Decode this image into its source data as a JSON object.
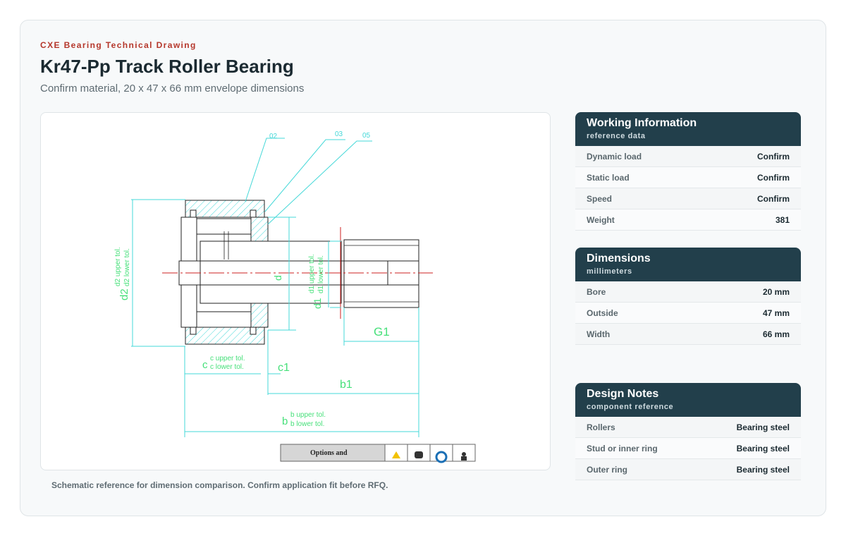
{
  "header": {
    "eyebrow": "CXE Bearing Technical Drawing",
    "title": "Kr47-Pp Track Roller Bearing",
    "subtitle": "Confirm material, 20 x 47 x 66 mm envelope dimensions"
  },
  "drawing": {
    "callouts": [
      "02",
      "03",
      "05"
    ],
    "dims": {
      "d2": "d2",
      "d2_upper": "d2 upper tol.",
      "d2_lower": "d2 lower tol.",
      "d": "d",
      "d1": "d1",
      "d1_upper": "d1 upper tol.",
      "d1_lower": "d1 lower tol.",
      "g1": "G1",
      "c": "c",
      "c_upper": "c upper tol.",
      "c_lower": "c lower tol.",
      "c1": "c1",
      "b1": "b1",
      "b": "b",
      "b_upper": "b upper tol.",
      "b_lower": "b lower tol."
    },
    "options_label": "Options and"
  },
  "caption": "Schematic reference for dimension comparison. Confirm application fit before RFQ.",
  "panels": {
    "working": {
      "title": "Working Information",
      "subtitle": "reference data",
      "rows": [
        {
          "label": "Dynamic load",
          "value": "Confirm"
        },
        {
          "label": "Static load",
          "value": "Confirm"
        },
        {
          "label": "Speed",
          "value": "Confirm"
        },
        {
          "label": "Weight",
          "value": "381"
        }
      ]
    },
    "dimensions": {
      "title": "Dimensions",
      "subtitle": "millimeters",
      "rows": [
        {
          "label": "Bore",
          "value": "20 mm"
        },
        {
          "label": "Outside",
          "value": "47 mm"
        },
        {
          "label": "Width",
          "value": "66 mm"
        }
      ]
    },
    "notes": {
      "title": "Design Notes",
      "subtitle": "component reference",
      "rows": [
        {
          "label": "Rollers",
          "value": "Bearing steel"
        },
        {
          "label": "Stud or inner ring",
          "value": "Bearing steel"
        },
        {
          "label": "Outer ring",
          "value": "Bearing steel"
        }
      ]
    }
  },
  "colors": {
    "accent": "#b5372b",
    "panel_header": "#223f4b",
    "dimension_green": "#46e07a",
    "leader_cyan": "#44d8d8",
    "centerline_red": "#cc2222"
  }
}
